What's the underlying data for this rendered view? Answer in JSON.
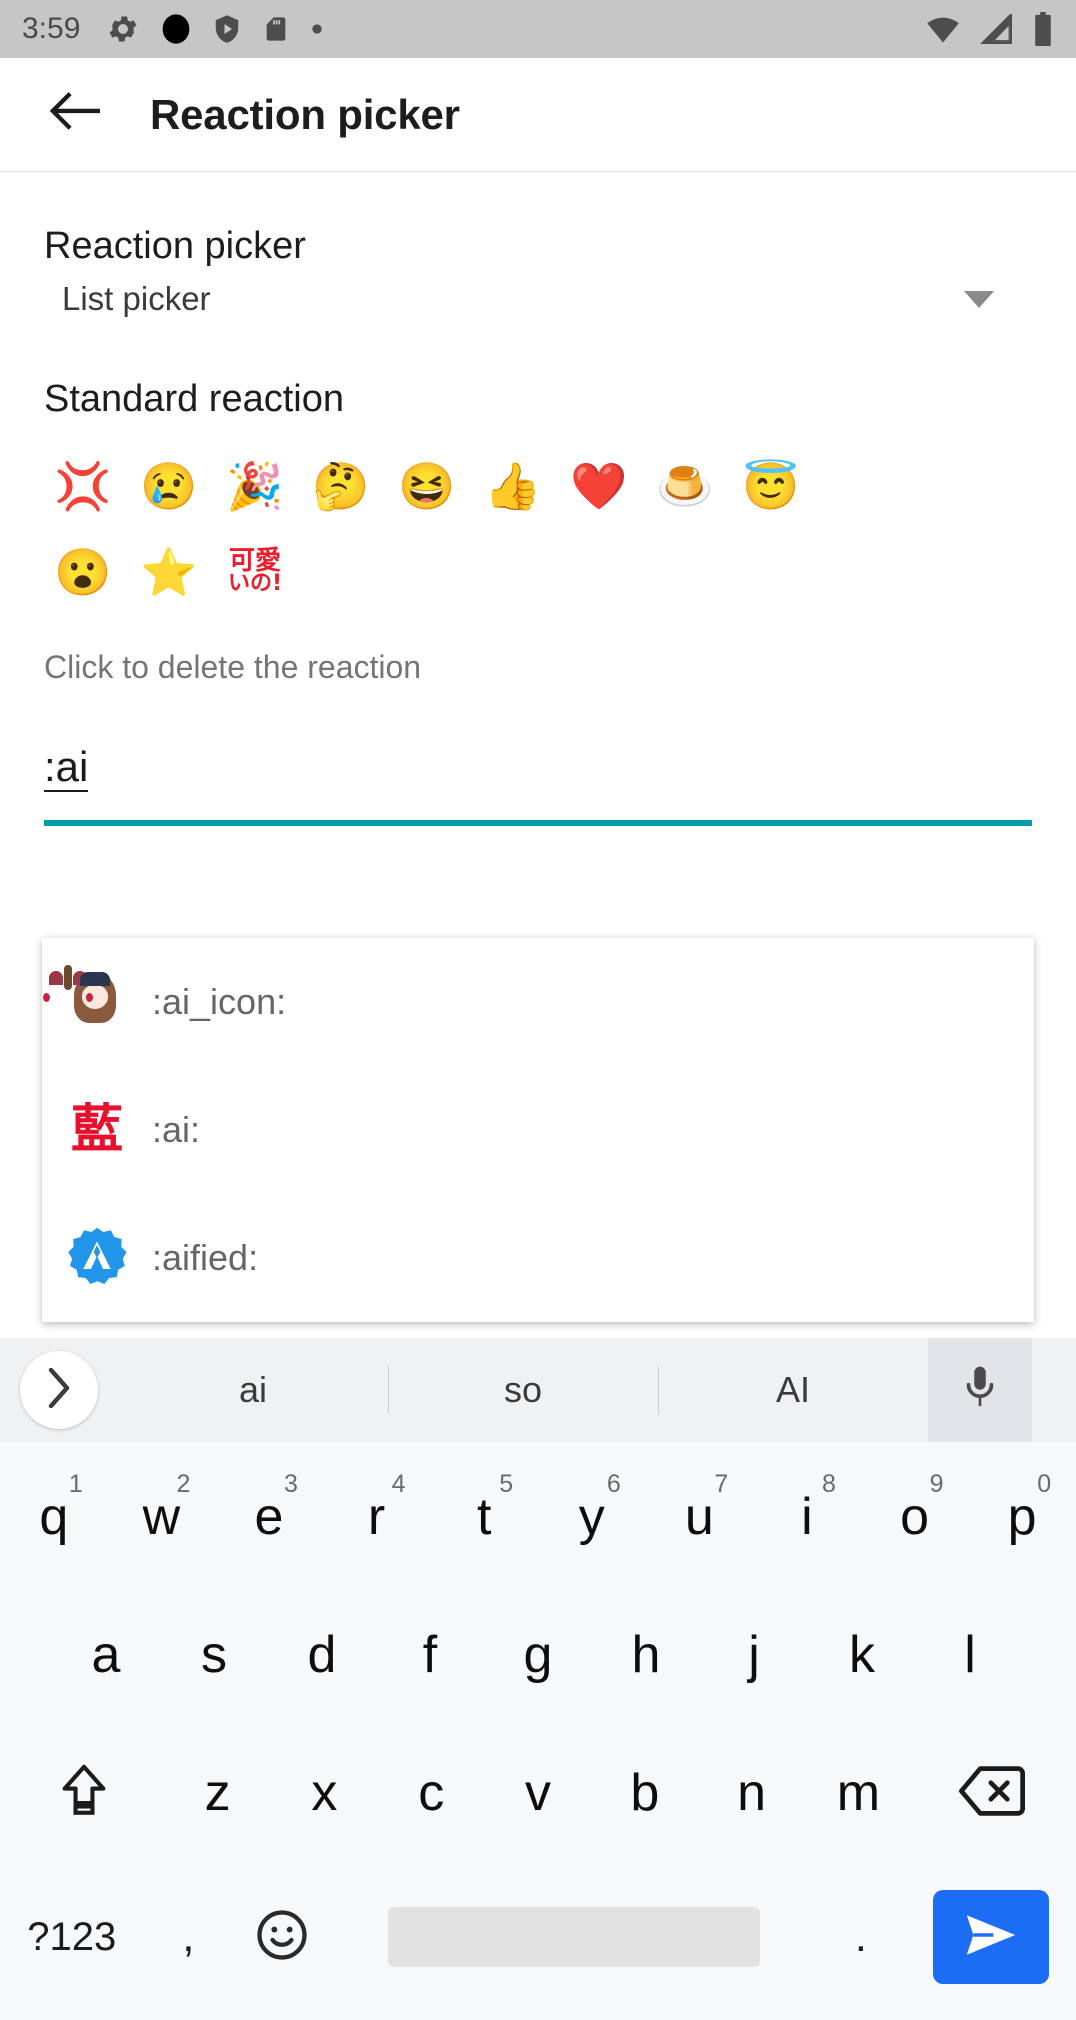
{
  "statusbar": {
    "time": "3:59",
    "left_icons": [
      "gear-icon",
      "black-circle-icon",
      "shield-play-icon",
      "sd-card-icon",
      "dot-icon"
    ],
    "right_icons": [
      "wifi-icon",
      "signal-icon",
      "battery-icon"
    ]
  },
  "appbar": {
    "back": "back-arrow-icon",
    "title": "Reaction picker"
  },
  "preference": {
    "title": "Reaction picker",
    "value": "List picker"
  },
  "standard_reaction": {
    "title": "Standard reaction",
    "hint": "Click to delete the reaction",
    "emojis": [
      {
        "name": "anger-symbol",
        "glyph": "💢"
      },
      {
        "name": "crying-face",
        "glyph": "😢"
      },
      {
        "name": "party-popper",
        "glyph": "🎉"
      },
      {
        "name": "thinking-face",
        "glyph": "🤔"
      },
      {
        "name": "grinning-squinting-face",
        "glyph": "😆"
      },
      {
        "name": "thumbs-up",
        "glyph": "👍"
      },
      {
        "name": "red-heart",
        "glyph": "❤️"
      },
      {
        "name": "custard-pudding",
        "glyph": "🍮"
      },
      {
        "name": "smiling-face-with-halo",
        "glyph": "😇"
      },
      {
        "name": "face-with-open-mouth",
        "glyph": "😮"
      },
      {
        "name": "star",
        "glyph": "⭐"
      },
      {
        "name": "kawaii-custom-emoji",
        "glyph": ""
      }
    ],
    "custom_emoji_text_top": "可愛",
    "custom_emoji_text_bottom": "いの!"
  },
  "input": {
    "value": ":ai"
  },
  "suggestions": [
    {
      "label": ":ai_icon:",
      "icon": "ai-icon-avatar"
    },
    {
      "label": ":ai:",
      "icon": "kanji-ai-icon",
      "glyph": "藍"
    },
    {
      "label": ":aified:",
      "icon": "aified-badge-icon"
    }
  ],
  "keyboard": {
    "suggestion_expand": "chevron-right-icon",
    "suggestions": [
      "ai",
      "so",
      "AI"
    ],
    "mic": "microphone-icon",
    "row1": [
      {
        "letter": "q",
        "num": "1"
      },
      {
        "letter": "w",
        "num": "2"
      },
      {
        "letter": "e",
        "num": "3"
      },
      {
        "letter": "r",
        "num": "4"
      },
      {
        "letter": "t",
        "num": "5"
      },
      {
        "letter": "y",
        "num": "6"
      },
      {
        "letter": "u",
        "num": "7"
      },
      {
        "letter": "i",
        "num": "8"
      },
      {
        "letter": "o",
        "num": "9"
      },
      {
        "letter": "p",
        "num": "0"
      }
    ],
    "row2": [
      "a",
      "s",
      "d",
      "f",
      "g",
      "h",
      "j",
      "k",
      "l"
    ],
    "row3": [
      "z",
      "x",
      "c",
      "v",
      "b",
      "n",
      "m"
    ],
    "shift": "shift-icon",
    "backspace": "backspace-icon",
    "symbols_label": "?123",
    "comma": ",",
    "emoji_key": "emoji-smiley-icon",
    "period": ".",
    "send": "send-icon"
  },
  "colors": {
    "accent_teal": "#009daf",
    "send_blue": "#1b6ef3",
    "statusbar_gray": "#c6c6c6",
    "kanji_red": "#e8112d",
    "badge_blue": "#2196e8"
  }
}
